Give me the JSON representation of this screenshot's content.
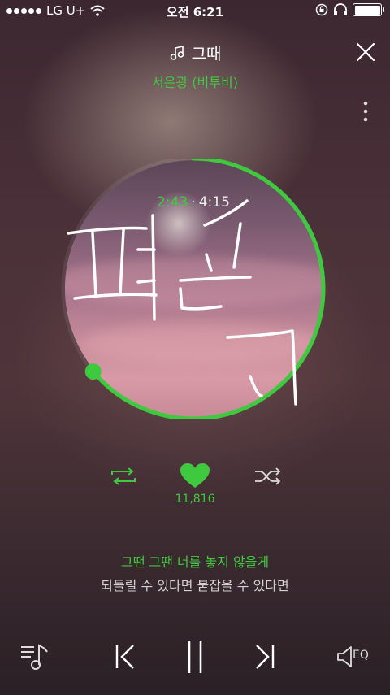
{
  "status_bar": {
    "carrier": "LG U+",
    "time": "오전 6:21",
    "icons": [
      "signal-dots-icon",
      "wifi-icon",
      "rotation-lock-icon",
      "headphones-icon",
      "battery-icon"
    ]
  },
  "header": {
    "title": "그때",
    "title_icon": "music-note-icon",
    "artist": "서은광 (비투비)",
    "close_icon": "close-icon",
    "more_icon": "more-vertical-icon"
  },
  "player": {
    "current_time": "2:43",
    "separator": "·",
    "total_time": "4:15",
    "progress_fraction": 0.64,
    "accent_color": "#3ec93e"
  },
  "actions": {
    "repeat_icon": "repeat-icon",
    "like_icon": "heart-icon",
    "like_count": "11,816",
    "shuffle_icon": "shuffle-icon"
  },
  "lyrics": {
    "current": "그땐 그땐 너를 놓지 않을게",
    "next": "되돌릴 수 있다면 붙잡을 수 있다면"
  },
  "controls": {
    "playlist_icon": "playlist-icon",
    "prev_icon": "previous-icon",
    "pause_icon": "pause-icon",
    "next_icon": "next-icon",
    "eq_label": "EQ"
  },
  "handwriting": {
    "text": "편곡"
  }
}
